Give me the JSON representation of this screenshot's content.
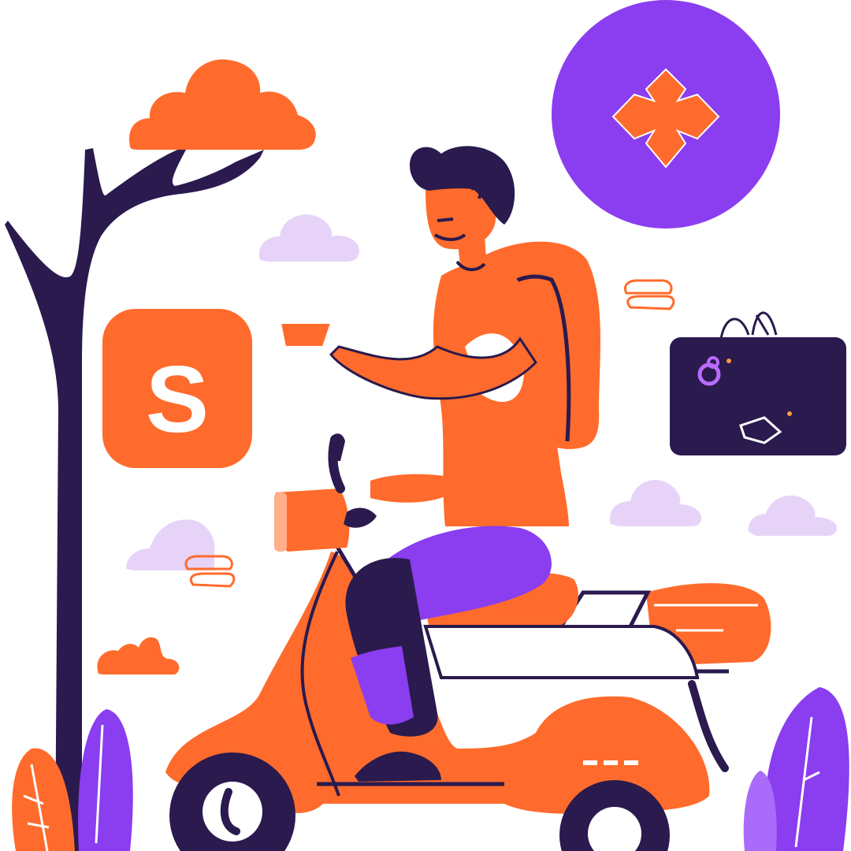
{
  "scene": {
    "description_icons": {
      "dollar_badge": "dollar-sign-icon",
      "location_badge": "map-pin-icon",
      "delivery_bag": "delivery-bag-icon"
    },
    "badge_glyph": "S"
  },
  "colors": {
    "orange": "#FF6B2C",
    "purple": "#8B3DF0",
    "navy": "#2A1A4E",
    "lilac": "#E7D3F8",
    "skin": "#FF7A3A",
    "white": "#FFFFFF"
  }
}
